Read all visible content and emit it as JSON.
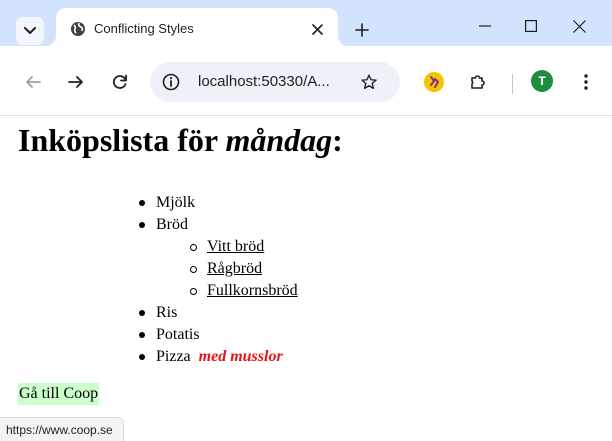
{
  "browser": {
    "tab": {
      "title": "Conflicting Styles"
    },
    "omnibox": {
      "url": "localhost:50330/A..."
    },
    "profile": {
      "initial": "T"
    },
    "colors": {
      "tabstrip": "#d3e3fd",
      "omnibox_bg": "#eef1f8",
      "avatar": "#1e8e3e",
      "extension": "#f5c400"
    }
  },
  "page": {
    "heading": {
      "prefix": "Inköpslista för ",
      "emphasis": "måndag",
      "suffix": ":"
    },
    "list": {
      "items": [
        "Mjölk",
        "Bröd",
        "Ris",
        "Potatis",
        "Pizza"
      ],
      "sub_items": [
        "Vitt bröd",
        "Rågbröd",
        "Fullkornsbröd"
      ],
      "pizza_emphasis": "med musslor"
    },
    "link": {
      "label": "Gå till Coop",
      "highlight": "#ccffcc"
    },
    "emphasis_color": "#ee1111"
  },
  "status_bar": {
    "url": "https://www.coop.se"
  }
}
